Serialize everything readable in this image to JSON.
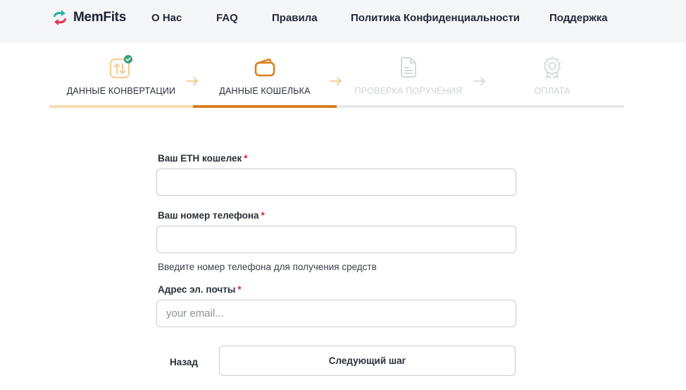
{
  "header": {
    "brand": "MemFits",
    "nav": [
      {
        "label": "О Нас"
      },
      {
        "label": "FAQ"
      },
      {
        "label": "Правила"
      },
      {
        "label": "Политика Конфиденциальности"
      },
      {
        "label": "Поддержка"
      }
    ]
  },
  "stepper": {
    "current_step": 2,
    "steps": [
      {
        "label": "ДАННЫЕ КОНВЕРТАЦИИ",
        "state": "completed",
        "icon": "transfer-arrows-icon"
      },
      {
        "label": "ДАННЫЕ КОШЕЛЬКА",
        "state": "active",
        "icon": "wallet-icon"
      },
      {
        "label": "ПРОВЕРКА ПОРУЧЕНИЯ",
        "state": "pending",
        "icon": "document-icon"
      },
      {
        "label": "ОПЛАТА",
        "state": "pending",
        "icon": "award-badge-icon"
      }
    ]
  },
  "form": {
    "eth_wallet": {
      "label": "Ваш ETH кошелек",
      "required_mark": "*",
      "value": "",
      "placeholder": ""
    },
    "phone": {
      "label": "Ваш номер телефона",
      "required_mark": "*",
      "value": "",
      "placeholder": "",
      "hint": "Введите номер телефона для получения средств"
    },
    "email": {
      "label": "Адрес эл. почты",
      "required_mark": "*",
      "value": "",
      "placeholder": "your email..."
    },
    "back_label": "Назад",
    "next_label": "Следующий шаг"
  },
  "colors": {
    "accent": "#d9801f",
    "accent_light": "#f6dcb0",
    "success": "#3aa17e",
    "inactive": "#d5d8dc",
    "required": "#d7263d"
  }
}
